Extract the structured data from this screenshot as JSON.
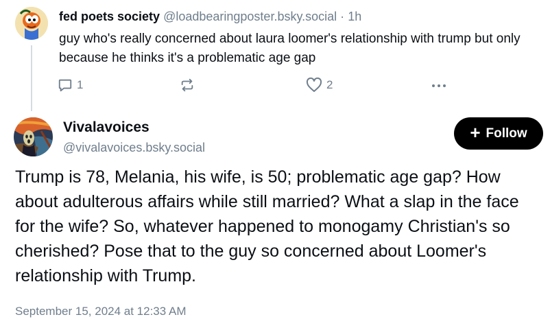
{
  "parent_post": {
    "avatar_icon": "cartoon-character-avatar",
    "author_name": "fed poets society",
    "author_handle": "@loadbearingposter.bsky.social",
    "separator": "·",
    "time_ago": "1h",
    "text": "guy who's really concerned about laura loomer's relationship with trump but only because he thinks it's a problematic age gap",
    "actions": {
      "reply_icon": "speech-bubble-icon",
      "reply_count": "1",
      "repost_icon": "repost-arrows-icon",
      "like_icon": "heart-icon",
      "like_count": "2",
      "more_icon": "ellipsis-icon"
    }
  },
  "main_post": {
    "avatar_icon": "scream-painting-avatar",
    "author_name": "Vivalavoices",
    "author_handle": "@vivalavoices.bsky.social",
    "follow_label": "Follow",
    "follow_icon": "+",
    "text": "Trump is 78, Melania, his wife, is 50; problematic age gap? How about adulterous affairs while still married? What a slap in the face for the wife? So, whatever happened to monogamy Christian's so cherished? Pose that to the guy so concerned about Loomer's relationship with Trump.",
    "timestamp": "September 15, 2024 at 12:33 AM"
  },
  "colors": {
    "text_primary": "#0b0f14",
    "text_secondary": "#6f7e8c",
    "thread_line": "#d4dbe2",
    "follow_bg": "#000000",
    "follow_text": "#ffffff"
  }
}
